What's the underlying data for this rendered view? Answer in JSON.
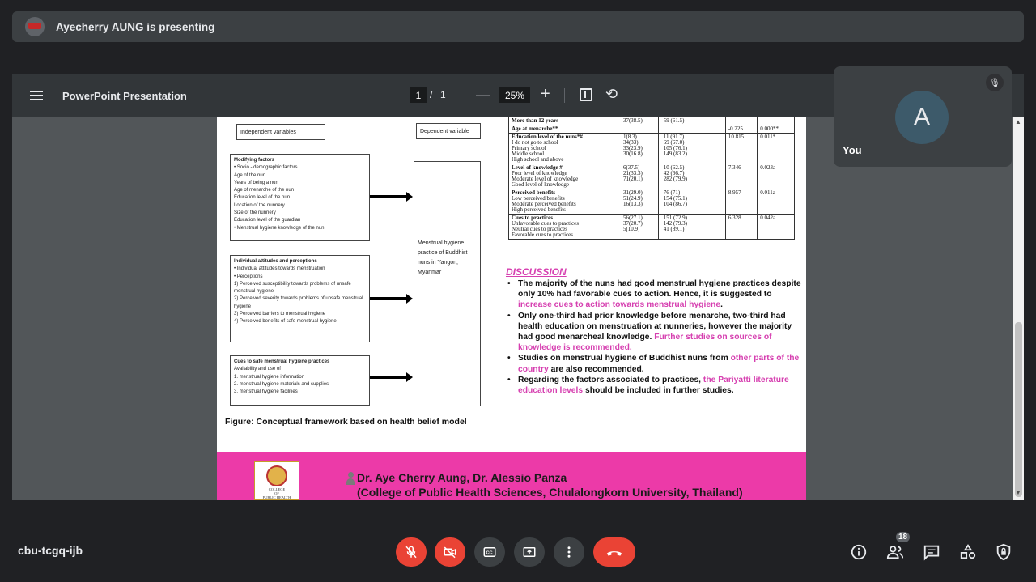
{
  "banner": {
    "presenter_text": "Ayecherry AUNG is presenting"
  },
  "viewer": {
    "title": "PowerPoint Presentation",
    "page_current": "1",
    "page_sep": "/",
    "page_total": "1",
    "zoom": "25%",
    "zoom_out": "—",
    "zoom_in": "+"
  },
  "slide": {
    "framework": {
      "independent_label": "Independent variables",
      "dependent_label": "Dependent variable",
      "modifying": {
        "title": "Modifying factors",
        "items": [
          "•   Socio - demographic factors",
          "Age of the nun",
          "Years of being a nun",
          "Age of menarche of the nun",
          "Education level of the nun",
          "Location of the nunnery",
          "Size of the nunnery",
          "Education level of the guardian",
          "•   Menstrual hygiene knowledge of the nun"
        ]
      },
      "attitudes": {
        "title": "Individual attitudes and perceptions",
        "items": [
          "•   Individual attitudes towards menstruation",
          "•   Perceptions",
          "1)  Perceived susceptibility towards problems of unsafe menstrual hygiene",
          "2)  Perceived severity towards problems of unsafe menstrual hygiene",
          "3)  Perceived barriers to menstrual hygiene",
          "4)  Perceived benefits of safe menstrual hygiene"
        ]
      },
      "cues": {
        "title": "Cues to safe menstrual hygiene practices",
        "items": [
          "Availability and use of",
          "1.   menstrual hygiene information",
          "2.   menstrual hygiene materials and supplies",
          "3.   menstrual hygiene facilities"
        ]
      },
      "dependent_text": "Menstrual hygiene practice of Buddhist nuns in Yangon, Myanmar",
      "caption": "Figure: Conceptual framework based on health belief model"
    },
    "table": [
      [
        "More than 12 years",
        "37(38.5)",
        "59 (61.5)",
        "",
        ""
      ],
      [
        "Age at menarche**",
        "",
        "",
        "-0.225",
        "0.000**"
      ],
      [
        "Education level of the nuns*#\nI do not go to school\nPrimary school\nMiddle school\nHigh school and above",
        "1(8.3)\n34(33)\n33(23.9)\n30(16.8)",
        "11 (91.7)\n69 (67.0)\n105 (76.1)\n149 (83.2)",
        "10.815",
        "0.011*"
      ],
      [
        "Level of knowledge #\nPoor level of knowledge\nModerate level of knowledge\nGood level of knowledge",
        "6(37.5)\n21(33.3)\n71(20.1)",
        "10 (62.5)\n42 (66.7)\n282 (79.9)",
        "7.346",
        "0.023a"
      ],
      [
        "Perceived benefits\nLow perceived benefits\nModerate perceived benefits\nHigh perceived benefits",
        "31(29.0)\n51(24.9)\n16(13.3)",
        "76 (71)\n154 (75.1)\n104 (86.7)",
        "8.957",
        "0.011a"
      ],
      [
        "Cues to practices\nUnfavorable cues to practices\nNeutral cues to practices\nFavorable cues to practices",
        "56(27.1)\n37(20.7)\n5(10.9)",
        "151 (72.9)\n142 (79.3)\n41 (89.1)",
        "6.328",
        "0.042a"
      ]
    ],
    "discussion": {
      "heading": "DISCUSSION",
      "p1a": "The majority of the nuns had good menstrual hygiene practices despite only 10% had favorable cues to action. Hence, it is suggested to ",
      "p1b": "increase cues to action towards menstrual hygiene",
      "p1c": ".",
      "p2a": "Only one-third had prior knowledge before menarche, two-third had health education on menstruation at nunneries, however the majority had good menarcheal knowledge. ",
      "p2b": "Further studies on sources of knowledge is recommended.",
      "p3a": "Studies on menstrual hygiene of Buddhist nuns from ",
      "p3b": "other parts of the country",
      "p3c": " are also recommended.",
      "p4a": "Regarding the factors associated to practices, ",
      "p4b": "the Pariyatti literature education levels",
      "p4c": " should be included in further studies."
    },
    "footer": {
      "authors": "Dr. Aye Cherry Aung, Dr. Alessio Panza",
      "affiliation": "(College of Public Health Sciences, Chulalongkorn University, Thailand)",
      "logo_text": "COLLEGE\nOF\nPUBLIC HEALTH SCIENCES"
    }
  },
  "self_tile": {
    "initial": "A",
    "name": "You"
  },
  "bottom": {
    "meeting_code": "cbu-tcgq-ijb",
    "participants": "18"
  },
  "colors": {
    "accent_pink": "#ec3aa8",
    "danger": "#ea4335",
    "bg": "#202124"
  }
}
